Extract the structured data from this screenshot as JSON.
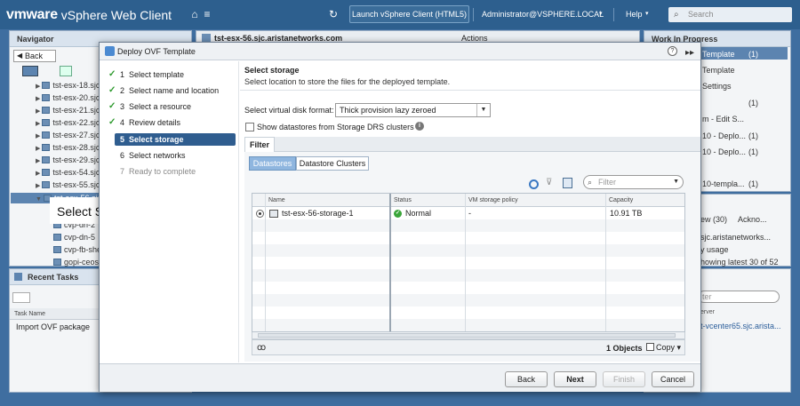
{
  "topbar": {
    "brand": "vmware",
    "product": "vSphere Web Client",
    "launch_label": "Launch vSphere Client (HTML5)",
    "user": "Administrator@VSPHERE.LOCAL",
    "help": "Help",
    "search_placeholder": "Search"
  },
  "navigator": {
    "title": "Navigator",
    "back_label": "Back",
    "items": [
      "tst-esx-18.sjc",
      "tst-esx-20.sjc",
      "tst-esx-21.sjc",
      "tst-esx-22.sjc",
      "tst-esx-27.sjc",
      "tst-esx-28.sjc",
      "tst-esx-29.sjc",
      "tst-esx-54.sjc",
      "tst-esx-55.sjc",
      "tst-esx-56.sjc",
      "cvp-dn-2",
      "cvp-dn-5",
      "cvp-fb-she",
      "gopi-ceos-"
    ]
  },
  "center_header": {
    "host": "tst-esx-56.sjc.aristanetworks.com",
    "actions": "Actions"
  },
  "wip": {
    "title": "Work In Progress",
    "items": [
      {
        "text": "Template",
        "count": "(1)"
      },
      {
        "text": "Template",
        "count": ""
      },
      {
        "text": "Settings",
        "count": ""
      },
      {
        "text": "",
        "count": "(1)"
      },
      {
        "text": "m - Edit S...",
        "count": ""
      },
      {
        "text": "10 - Deplo...",
        "count": "(1)"
      },
      {
        "text": "10 - Deplo...",
        "count": "(1)"
      },
      {
        "text": "10-templa...",
        "count": "(1)"
      }
    ]
  },
  "alarms": {
    "tab1": "ew (30)",
    "tab2": "Ackno...",
    "line1": "sjc.aristanetworks...",
    "line2": "y usage",
    "line3": "howing latest 30 of 52",
    "filter_placeholder": "ter",
    "server_label": "erver",
    "server_value": "t-vcenter65.sjc.arista..."
  },
  "recent_tasks": {
    "title": "Recent Tasks",
    "col_task": "Task Name",
    "task": "Import OVF package"
  },
  "dialog": {
    "title": "Deploy OVF Template",
    "steps": [
      {
        "num": "1",
        "label": "Select template",
        "state": "done"
      },
      {
        "num": "2",
        "label": "Select name and location",
        "state": "done"
      },
      {
        "num": "3",
        "label": "Select a resource",
        "state": "done"
      },
      {
        "num": "4",
        "label": "Review details",
        "state": "done"
      },
      {
        "num": "5",
        "label": "Select storage",
        "state": "current"
      },
      {
        "num": "6",
        "label": "Select networks",
        "state": "pending"
      },
      {
        "num": "7",
        "label": "Ready to complete",
        "state": "disabled"
      }
    ],
    "content": {
      "title": "Select storage",
      "description": "Select location to store the files for the deployed template.",
      "disk_format_label": "Select virtual disk format:",
      "disk_format_value": "Thick provision lazy zeroed",
      "drs_checkbox_label": "Show datastores from Storage DRS clusters",
      "filter_tab": "Filter",
      "seg_datastores": "Datastores",
      "seg_clusters": "Datastore Clusters",
      "filter_placeholder": "Filter",
      "columns": [
        "Name",
        "Status",
        "VM storage policy",
        "Capacity"
      ],
      "rows": [
        {
          "name": "tst-esx-56-storage-1",
          "status": "Normal",
          "policy": "-",
          "capacity": "10.91  TB"
        }
      ],
      "object_count": "1 Objects",
      "copy_label": "Copy"
    },
    "buttons": {
      "back": "Back",
      "next": "Next",
      "finish": "Finish",
      "cancel": "Cancel"
    }
  },
  "annotation": "Select Storage Location"
}
